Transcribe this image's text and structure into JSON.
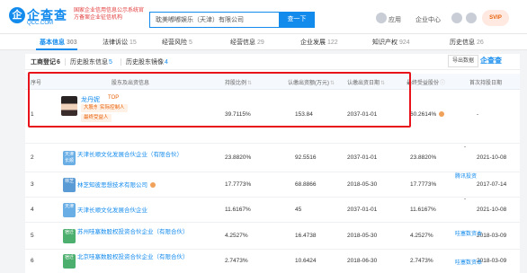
{
  "header": {
    "logo_char": "企",
    "logo_name": "企查查",
    "logo_domain": "QCC.COM",
    "gov_note": "国家企业信用信息公示系统官方备案企业征信机构",
    "search_value": "耽美嘟嘟娱乐（天津）有限公司",
    "search_button": "查一下",
    "app_label": "应用",
    "biz_label": "企业中心",
    "vip_label": "SVIP"
  },
  "nav": {
    "tabs": [
      {
        "label": "基本信息",
        "count": "303"
      },
      {
        "label": "法律诉讼",
        "count": "15"
      },
      {
        "label": "经营风险",
        "count": "5"
      },
      {
        "label": "经营信息",
        "count": "29"
      },
      {
        "label": "企业发展",
        "count": "122"
      },
      {
        "label": "知识产权",
        "count": "924"
      },
      {
        "label": "历史信息",
        "count": "26"
      }
    ]
  },
  "sub_tabs": [
    {
      "label": "工商登记",
      "count": "6"
    },
    {
      "label": "历史股东信息",
      "count": "5"
    },
    {
      "label": "历史股东镜像",
      "count": "4"
    }
  ],
  "toolbar": {
    "export_label": "导出数据",
    "brand_label": "企查查"
  },
  "table": {
    "headers": {
      "index": "序号",
      "shareholder": "股东及出资信息",
      "ratio": "持股比例",
      "amount": "认缴出资额(万元)",
      "date": "认缴出资日期",
      "final": "最终受益股份",
      "first": "首次持股日期",
      "relation": "关联产品/机构"
    },
    "rows": [
      {
        "index": "1",
        "name": "龙丹妮",
        "badge": "TOP",
        "tags": [
          "大股东",
          "实际控制人",
          "最终受益人"
        ],
        "ratio": "39.7115%",
        "amount": "153.84",
        "date": "2037-01-01",
        "final": "60.2614%",
        "first": "-",
        "relation": ""
      },
      {
        "index": "2",
        "logo": "天津长顺",
        "name": "天津长顺文化发展合伙企业（有限合伙）",
        "ratio": "23.8820%",
        "amount": "92.5516",
        "date": "2037-01-01",
        "final": "23.8820%",
        "first": "2021-10-08",
        "relation": "-"
      },
      {
        "index": "3",
        "logo": "林芝",
        "name": "林芝知彼思想技术有限公司",
        "ratio": "17.7773%",
        "amount": "68.8866",
        "date": "2018-05-30",
        "final": "17.7773%",
        "first": "2017-07-14",
        "relation": "腾讯投资"
      },
      {
        "index": "4",
        "logo": "天津",
        "name": "天津长顺文化发展合伙企业",
        "ratio": "11.6167%",
        "amount": "45",
        "date": "2037-01-01",
        "final": "11.6167%",
        "first": "2021-10-08",
        "relation": "-"
      },
      {
        "index": "5",
        "logo": "宿迁",
        "name": "苏州哇塞数股权投资合伙企业（有限合伙）",
        "ratio": "4.2527%",
        "amount": "16.4738",
        "date": "2018-05-30",
        "final": "4.2527%",
        "first": "2018-03-09",
        "relation": "哇塞数资本"
      },
      {
        "index": "6",
        "logo": "宿迁",
        "name": "北京哇塞数股权投资合伙企业（有限合伙）",
        "ratio": "2.7473%",
        "amount": "10.6424",
        "date": "2018-06-30",
        "final": "2.7473%",
        "first": "2018-03-09",
        "relation": "哇塞数资本"
      }
    ]
  },
  "colors": {
    "brand": "#128bed",
    "highlight": "#e8121b",
    "tag_orange": "#e8620a"
  }
}
